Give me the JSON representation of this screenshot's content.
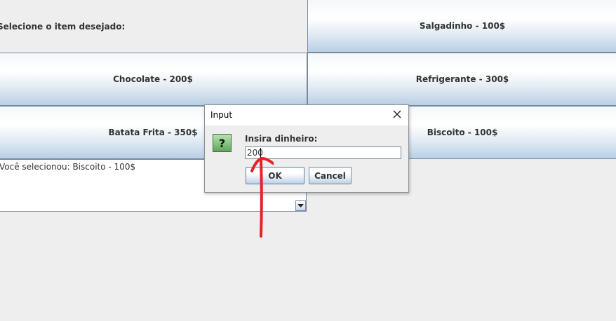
{
  "main": {
    "select_label": "Selecione o item desejado:",
    "items": [
      "Salgadinho - 100$",
      "Chocolate - 200$",
      "Refrigerante - 300$",
      "Batata Frita - 350$",
      "Biscoito - 100$"
    ],
    "output_text": "Você selecionou: Biscoito - 100$"
  },
  "dialog": {
    "title": "Input",
    "prompt": "Insira dinheiro:",
    "input_value": "200",
    "ok_label": "OK",
    "cancel_label": "Cancel",
    "icon": "question-icon",
    "icon_glyph": "?"
  },
  "colors": {
    "annotation_arrow": "#e3232b",
    "question_icon": "#5fa55a"
  }
}
